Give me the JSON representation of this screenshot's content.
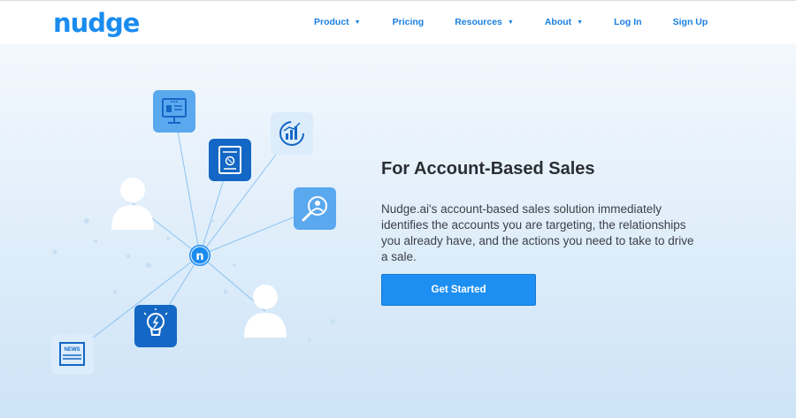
{
  "brand": {
    "logo_text": "nudge",
    "color": "#1a8cf0"
  },
  "nav": {
    "items": [
      {
        "label": "Product",
        "has_dropdown": true
      },
      {
        "label": "Pricing",
        "has_dropdown": false
      },
      {
        "label": "Resources",
        "has_dropdown": true
      },
      {
        "label": "About",
        "has_dropdown": true
      },
      {
        "label": "Log In",
        "has_dropdown": false
      },
      {
        "label": "Sign Up",
        "has_dropdown": false
      }
    ],
    "dropdown_icon": "▼"
  },
  "hero": {
    "title": "For Account-Based Sales",
    "description": "Nudge.ai's account-based sales solution immediately identifies the accounts you are targeting, the relationships you already have, and the actions you need to take to drive a sale.",
    "cta_label": "Get Started",
    "hub_letter": "n",
    "newspaper_label": "NEWS",
    "icons": [
      "computer-profile-icon",
      "phone-document-icon",
      "analytics-chart-icon",
      "search-person-icon",
      "lightbulb-icon",
      "newspaper-icon",
      "person-icon"
    ]
  },
  "colors": {
    "accent": "#1a8cf0",
    "cta": "#1d8ff2",
    "dark_tile": "#1467c4",
    "mid_tile": "#5aa8ee",
    "light_tile": "#dcecfb"
  }
}
